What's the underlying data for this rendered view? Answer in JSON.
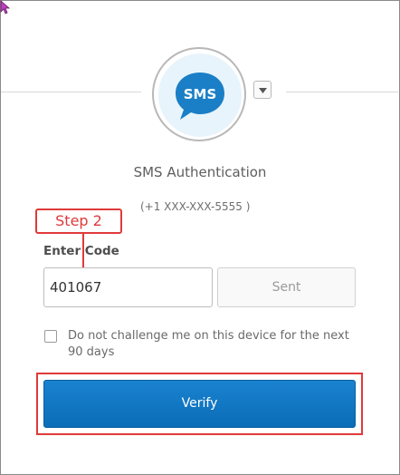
{
  "factor": {
    "icon_text": "SMS",
    "title": "SMS Authentication",
    "phone_masked": "(+1 XXX-XXX-5555 )"
  },
  "annotation": {
    "step_label": "Step 2"
  },
  "code_field": {
    "label": "Enter Code",
    "value": "401067"
  },
  "sent_button": {
    "label": "Sent"
  },
  "remember": {
    "label": "Do not challenge me on this device for the next 90 days",
    "checked": false
  },
  "verify_button": {
    "label": "Verify"
  },
  "colors": {
    "accent": "#0e76c4",
    "callout": "#e03a3a",
    "icon_bubble": "#1a7fc6",
    "icon_bg": "#e8f4fb"
  }
}
